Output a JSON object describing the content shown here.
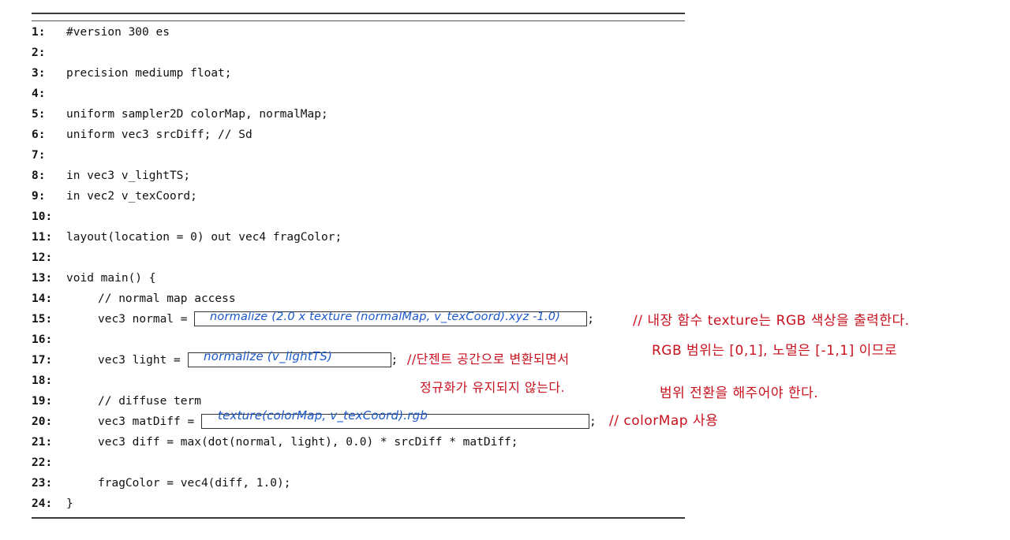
{
  "code_lines": [
    {
      "num": "1:",
      "text": "#version 300 es"
    },
    {
      "num": "2:",
      "text": ""
    },
    {
      "num": "3:",
      "text": "precision mediump float;"
    },
    {
      "num": "4:",
      "text": ""
    },
    {
      "num": "5:",
      "text": "uniform sampler2D colorMap, normalMap;"
    },
    {
      "num": "6:",
      "text": "uniform vec3 srcDiff; // Sd"
    },
    {
      "num": "7:",
      "text": ""
    },
    {
      "num": "8:",
      "text": "in vec3 v_lightTS;"
    },
    {
      "num": "9:",
      "text": "in vec2 v_texCoord;"
    },
    {
      "num": "10:",
      "text": ""
    },
    {
      "num": "11:",
      "text": "layout(location = 0) out vec4 fragColor;"
    },
    {
      "num": "12:",
      "text": ""
    },
    {
      "num": "13:",
      "text": "void main() {"
    },
    {
      "num": "14:",
      "text": "// normal map access"
    },
    {
      "num": "15:",
      "text": "vec3 normal = "
    },
    {
      "num": "16:",
      "text": ""
    },
    {
      "num": "17:",
      "text": "vec3 light = "
    },
    {
      "num": "18:",
      "text": ""
    },
    {
      "num": "19:",
      "text": "// diffuse term"
    },
    {
      "num": "20:",
      "text": "vec3 matDiff = "
    },
    {
      "num": "21:",
      "text": "vec3 diff = max(dot(normal, light), 0.0) * srcDiff * matDiff;"
    },
    {
      "num": "22:",
      "text": ""
    },
    {
      "num": "23:",
      "text": "fragColor = vec4(diff, 1.0);"
    },
    {
      "num": "24:",
      "text": "}"
    }
  ],
  "blank_suffix": ";",
  "answers": {
    "normal": "normalize (2.0 x texture (normalMap, v_texCoord).xyz -1.0)",
    "light": "normalize (v_lightTS)",
    "matDiff": "texture(colorMap, v_texCoord).rgb"
  },
  "notes": {
    "texture_rgb_1": "// 내장 함수 texture는 RGB 색상을 출력한다.",
    "texture_rgb_2": "RGB 범위는 [0,1], 노멀은 [-1,1] 이므로",
    "texture_rgb_3": "범위 전환을 해주어야 한다.",
    "light_1": "//단젠트 공간으로 변환되면서",
    "light_2": "정규화가 유지되지 않는다.",
    "colormap": "// colorMap 사용"
  },
  "colors": {
    "ink_blue": "#1a57c9",
    "ink_red": "#c8101e",
    "text": "#111111"
  }
}
